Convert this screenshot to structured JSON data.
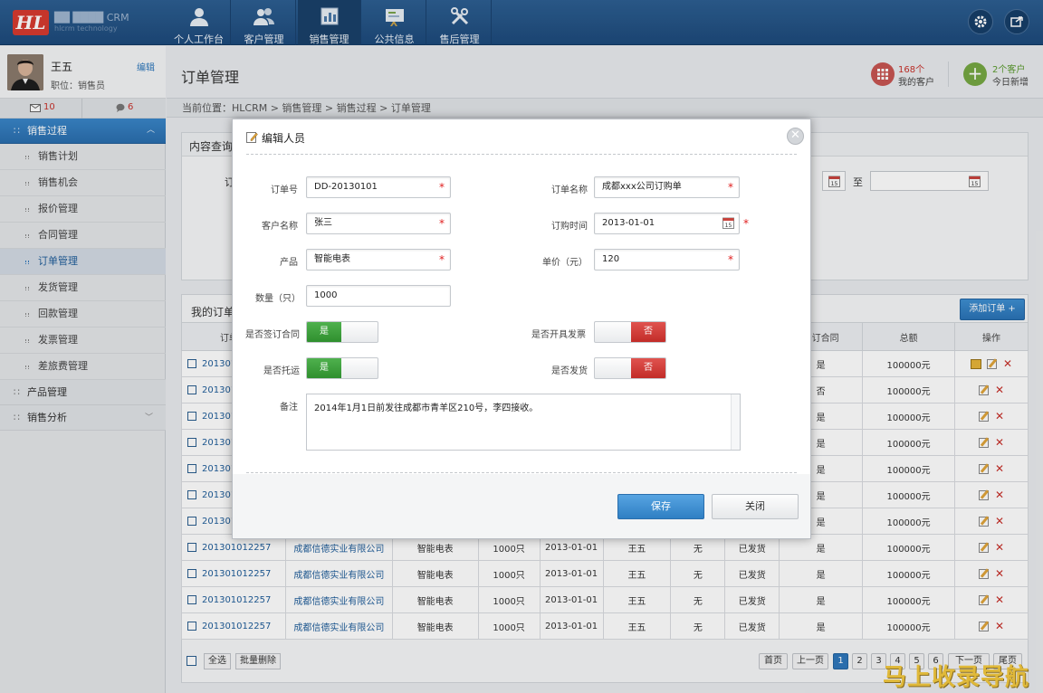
{
  "nav": [
    {
      "label": "个人工作台",
      "icon": "person-icon"
    },
    {
      "label": "客户管理",
      "icon": "group-icon"
    },
    {
      "label": "销售管理",
      "icon": "report-icon"
    },
    {
      "label": "公共信息",
      "icon": "info-board-icon"
    },
    {
      "label": "售后管理",
      "icon": "tools-icon"
    }
  ],
  "profile": {
    "name": "王五",
    "role": "职位：销售员",
    "edit": "编辑"
  },
  "messages": {
    "mail_count": "10",
    "chat_count": "6"
  },
  "sidebar": {
    "section1": "销售过程",
    "items": [
      "销售计划",
      "销售机会",
      "报价管理",
      "合同管理",
      "订单管理",
      "发货管理",
      "回款管理",
      "发票管理",
      "差旅费管理"
    ],
    "section2": "产品管理",
    "section3": "销售分析"
  },
  "page": {
    "title": "订单管理",
    "breadcrumb": "当前位置：HLCRM > 销售管理 > 销售过程 > 订单管理"
  },
  "stats": {
    "customers_count": "168个",
    "customers_label": "我的客户",
    "new_count": "2个客户",
    "new_label": "今日新增"
  },
  "query": {
    "title": "内容查询",
    "label_frag": "订",
    "to": "至"
  },
  "orders": {
    "title": "我的订单",
    "add_button": "添加订单 +",
    "headers_left": "订单",
    "headers": {
      "contract": "签订合同",
      "total": "总额",
      "ops": "操作"
    },
    "rows_hidden": [
      {
        "id": "201301",
        "contract": "是",
        "total": "100000元"
      },
      {
        "id": "201301",
        "contract": "否",
        "total": "100000元"
      },
      {
        "id": "201301",
        "contract": "是",
        "total": "100000元"
      },
      {
        "id": "201301",
        "contract": "是",
        "total": "100000元"
      },
      {
        "id": "201301",
        "contract": "是",
        "total": "100000元"
      },
      {
        "id": "201301",
        "contract": "是",
        "total": "100000元"
      },
      {
        "id": "201301",
        "contract": "是",
        "total": "100000元"
      }
    ],
    "rows": [
      {
        "id": "201301012257",
        "company": "成都信德实业有限公司",
        "product": "智能电表",
        "qty": "1000只",
        "date": "2013-01-01",
        "person": "王五",
        "invoice": "无",
        "status": "已发货",
        "contract": "是",
        "total": "100000元"
      },
      {
        "id": "201301012257",
        "company": "成都信德实业有限公司",
        "product": "智能电表",
        "qty": "1000只",
        "date": "2013-01-01",
        "person": "王五",
        "invoice": "无",
        "status": "已发货",
        "contract": "是",
        "total": "100000元"
      },
      {
        "id": "201301012257",
        "company": "成都信德实业有限公司",
        "product": "智能电表",
        "qty": "1000只",
        "date": "2013-01-01",
        "person": "王五",
        "invoice": "无",
        "status": "已发货",
        "contract": "是",
        "total": "100000元"
      },
      {
        "id": "201301012257",
        "company": "成都信德实业有限公司",
        "product": "智能电表",
        "qty": "1000只",
        "date": "2013-01-01",
        "person": "王五",
        "invoice": "无",
        "status": "已发货",
        "contract": "是",
        "total": "100000元"
      }
    ],
    "select_all": "全选",
    "batch_delete": "批量删除"
  },
  "pager": {
    "first": "首页",
    "prev": "上一页",
    "pages": [
      "1",
      "2",
      "3",
      "4",
      "5",
      "6"
    ],
    "next": "下一页",
    "last": "尾页"
  },
  "modal": {
    "title": "编辑人员",
    "order_no_label": "订单号",
    "order_no": "DD-20130101",
    "order_name_label": "订单名称",
    "order_name": "成都xxx公司订购单",
    "customer_label": "客户名称",
    "customer": "张三",
    "date_label": "订购时间",
    "date": "2013-01-01",
    "product_label": "产品",
    "product": "智能电表",
    "price_label": "单价（元）",
    "price": "120",
    "qty_label": "数量（只）",
    "qty": "1000",
    "contract_label": "是否签订合同",
    "contract_value": "是",
    "invoice_label": "是否开具发票",
    "invoice_value": "否",
    "consign_label": "是否托运",
    "consign_value": "是",
    "shipped_label": "是否发货",
    "shipped_value": "否",
    "notes_label": "备注",
    "notes": "2014年1月1日前发往成都市青羊区210号，李四接收。",
    "save": "保存",
    "close": "关闭"
  },
  "watermark": "马上收录导航",
  "colors": {
    "accent": "#2e77bb",
    "primary_btn": "#3d8fd1",
    "green": "#3a9a3a",
    "red": "#d23b36"
  }
}
